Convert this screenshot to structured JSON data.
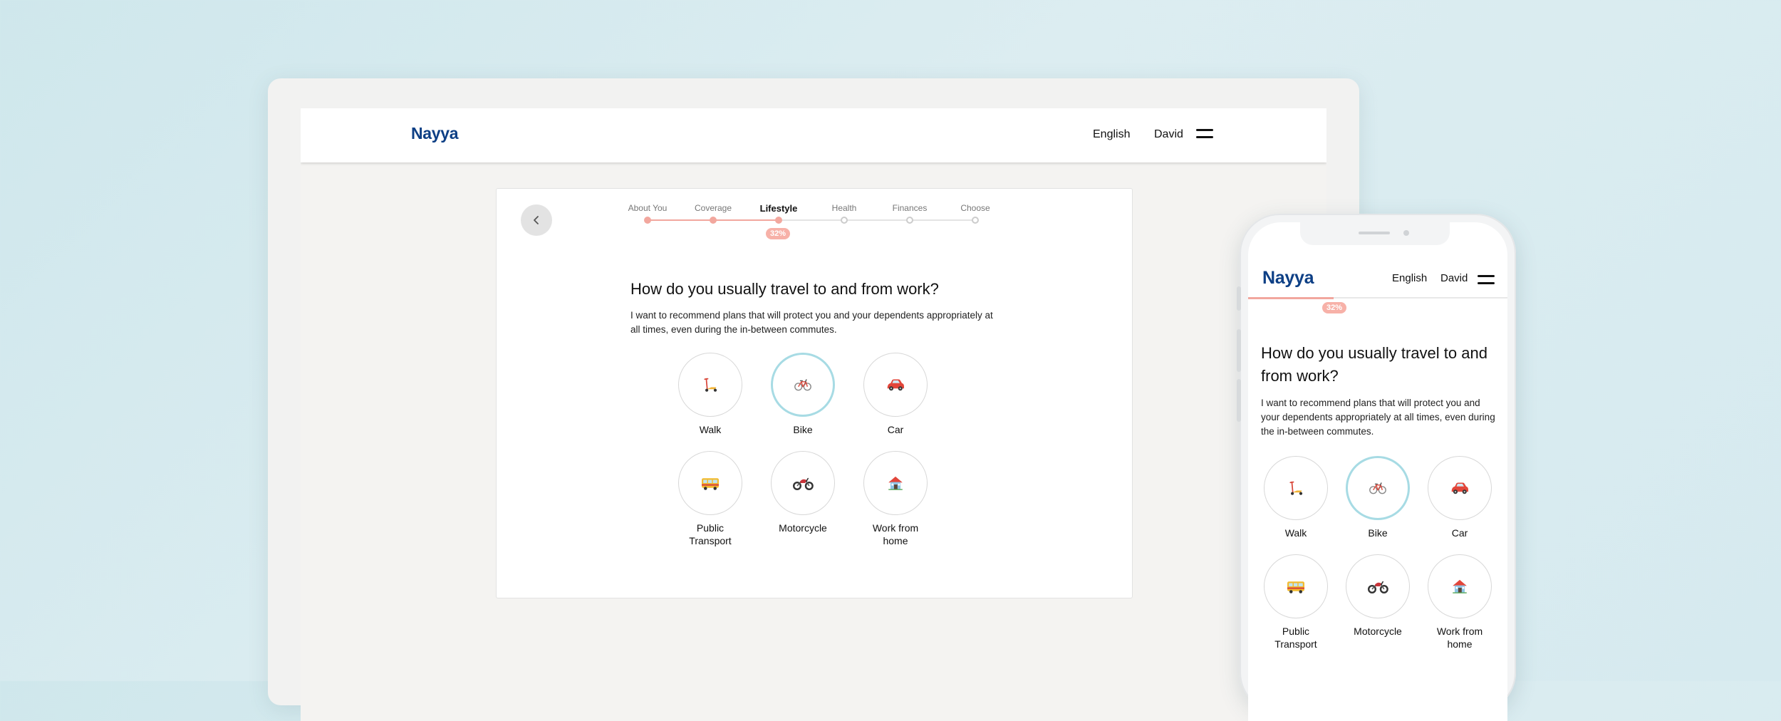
{
  "brand": {
    "logo": "Nayya",
    "logo_color": "#0d3f85",
    "accent": "#f2a79e",
    "selected_ring": "#a7dbe4"
  },
  "header": {
    "language": "English",
    "user": "David",
    "menu_icon": "hamburger-icon"
  },
  "progress": {
    "steps": [
      "About You",
      "Coverage",
      "Lifestyle",
      "Health",
      "Finances",
      "Choose"
    ],
    "active_step": "Lifestyle",
    "percent_label": "32%",
    "percent": 32
  },
  "question": {
    "title": "How do you usually travel to and from work?",
    "description": "I want to recommend plans that will protect you and your dependents appropriately at all times, even during the in-between commutes."
  },
  "options": [
    {
      "label": "Walk",
      "icon": "scooter-icon",
      "selected": false
    },
    {
      "label": "Bike",
      "icon": "bicycle-icon",
      "selected": true
    },
    {
      "label": "Car",
      "icon": "car-icon",
      "selected": false
    },
    {
      "label": "Public Transport",
      "icon": "bus-icon",
      "selected": false
    },
    {
      "label": "Motorcycle",
      "icon": "motorcycle-icon",
      "selected": false
    },
    {
      "label": "Work from home",
      "icon": "house-icon",
      "selected": false
    }
  ]
}
